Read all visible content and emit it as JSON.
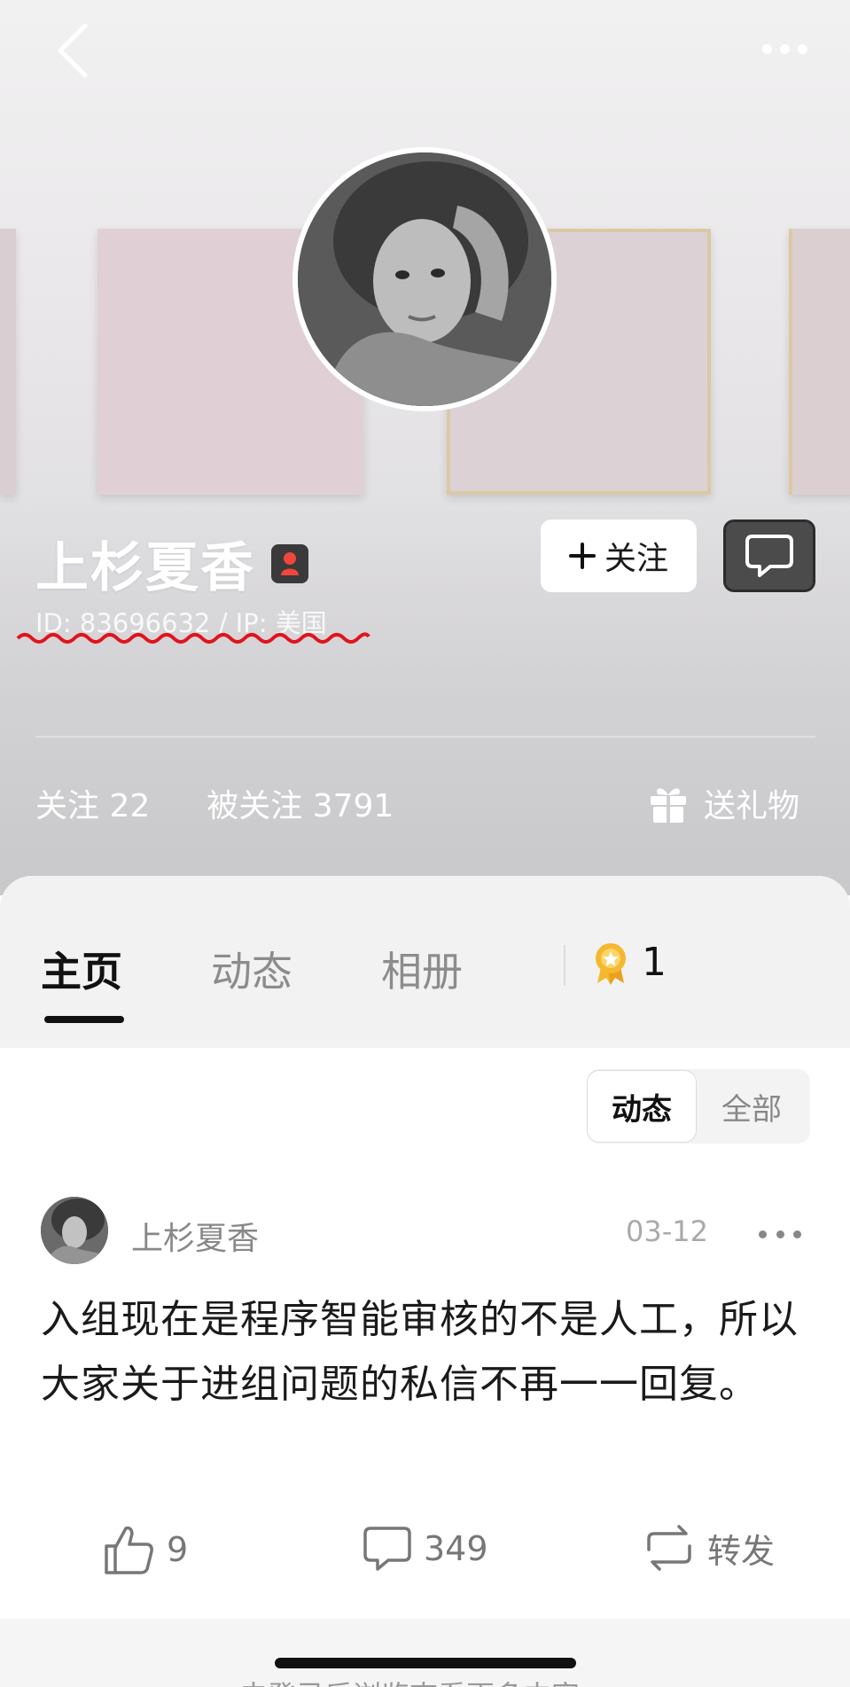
{
  "header": {
    "back_icon": "chevron-left-icon",
    "more_icon": "ellipsis-icon",
    "avatar_alt": "profile-photo"
  },
  "profile": {
    "name": "上杉夏香",
    "gender_icon": "female-icon",
    "id_ip": "ID: 83696632 / IP: 美国",
    "follow_label": "关注",
    "follow_icon": "plus-icon",
    "chat_icon": "chat-bubble-icon",
    "following": "关注 22",
    "followers": "被关注 3791",
    "gift_label": "送礼物",
    "gift_icon": "gift-icon"
  },
  "tabs": {
    "items": [
      "主页",
      "动态",
      "相册"
    ],
    "active": "主页",
    "medal_icon": "medal-icon",
    "medal_count": "1"
  },
  "filter": {
    "options": [
      "动态",
      "全部"
    ],
    "selected": "动态"
  },
  "post": {
    "author": "上杉夏香",
    "date": "03-12",
    "text": "入组现在是程序智能审核的不是人工，所以大家关于进组问题的私信不再一一回复。",
    "likes": "9",
    "comments": "349",
    "repost_label": "转发"
  },
  "footer": {
    "cut_text": "去登录后浏览查看更多内容"
  },
  "colors": {
    "accent_squiggle": "#e0141e",
    "badge_red": "#f0473d",
    "medal_gold": "#f5b82e"
  }
}
